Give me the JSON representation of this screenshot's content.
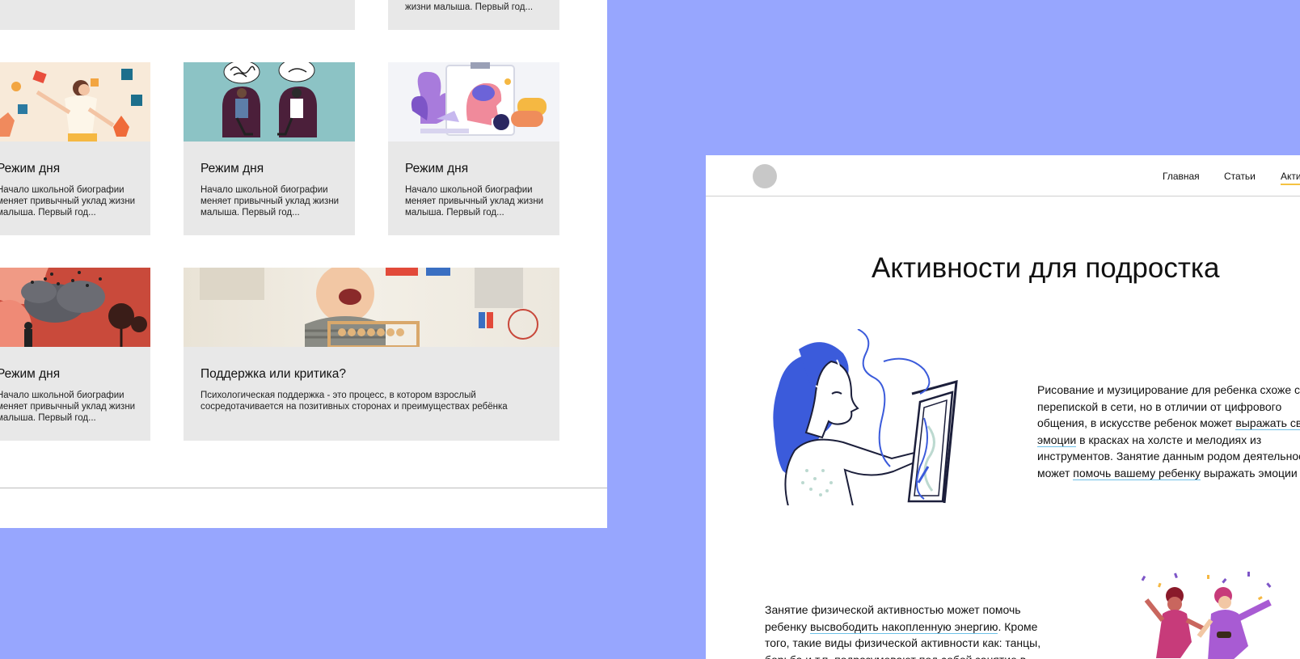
{
  "left_mockup": {
    "top_stub_card": {
      "desc": "жизни малыша. Первый год..."
    },
    "cards": [
      {
        "title": "Режим дня",
        "desc": "Начало школьной биографии меняет привычный уклад жизни малыша. Первый год..."
      },
      {
        "title": "Режим дня",
        "desc": "Начало школьной биографии меняет привычный уклад жизни малыша. Первый год..."
      },
      {
        "title": "Режим дня",
        "desc": "Начало школьной биографии меняет привычный уклад жизни малыша. Первый год..."
      },
      {
        "title": "Режим дня",
        "desc": "Начало школьной биографии меняет привычный уклад жизни малыша. Первый год..."
      },
      {
        "title": "Поддержка или критика?",
        "desc": "Психологическая поддержка - это процесс, в котором взрослый сосредотачивается на позитивных сторонах и преимуществах ребёнка"
      }
    ]
  },
  "right_mockup": {
    "nav": [
      "Главная",
      "Статьи",
      "Акти"
    ],
    "heading": "Активности для подростка",
    "para1": {
      "t1": "Рисование и музицирование для ребенка схоже с перепиской в сети, но в отличии от цифрового общения, в искусстве ребенок может ",
      "link1": "выражать свои эмоции",
      "t2": " в красках на холсте и мелодиях из инструментов. Занятие данным родом деятельности может ",
      "link2": "помочь вашему ребенку",
      "t3": " выражать эмоции"
    },
    "para2": {
      "t1": "Занятие физической активностью может помочь ребенку ",
      "link1": "высвободить накопленную энергию",
      "t2": ". Кроме того, такие виды физической активности как: танцы, борьба и т.п. подразумевают под собой занятие в"
    }
  }
}
